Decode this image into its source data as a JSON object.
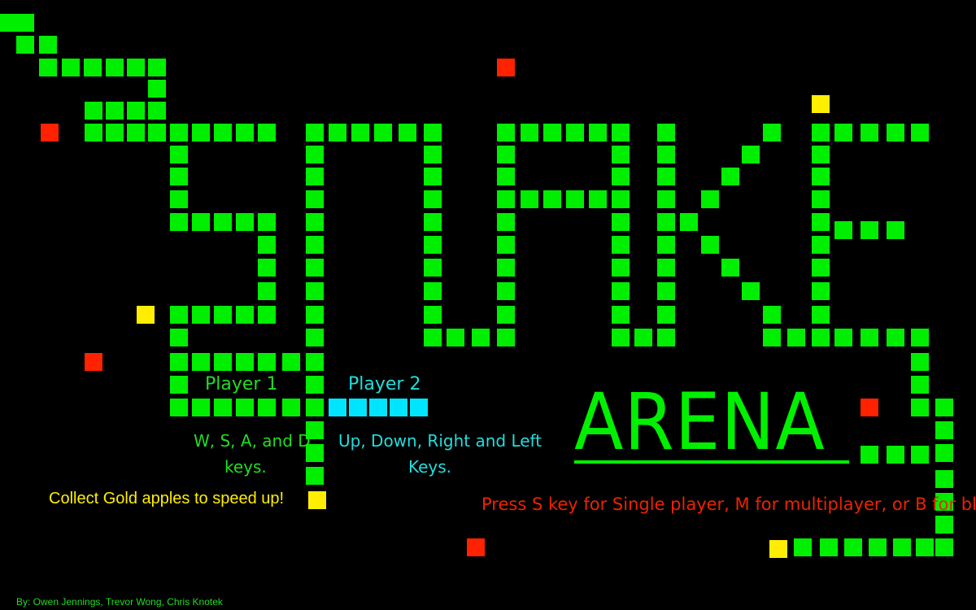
{
  "game": {
    "title_word": "ARENA",
    "player1_label": "Player 1",
    "player2_label": "Player 2",
    "player1_keys_line1": "W, S, A, and D",
    "player1_keys_line2": "keys.",
    "player2_keys_line1": "Up, Down, Right and Left",
    "player2_keys_line2": "Keys.",
    "gold_tip": "Collect Gold apples to speed up!",
    "mode_tip": "Press S key for Single player, M for multiplayer, or B for blitz!",
    "credits": "By: Owen Jennings, Trevor Wong, Chris Knotek"
  },
  "colors": {
    "snake": "#00ee00",
    "player2_snake": "#00e5ff",
    "red_apple": "#ff2200",
    "gold_apple": "#ffee00",
    "background": "#000000"
  }
}
